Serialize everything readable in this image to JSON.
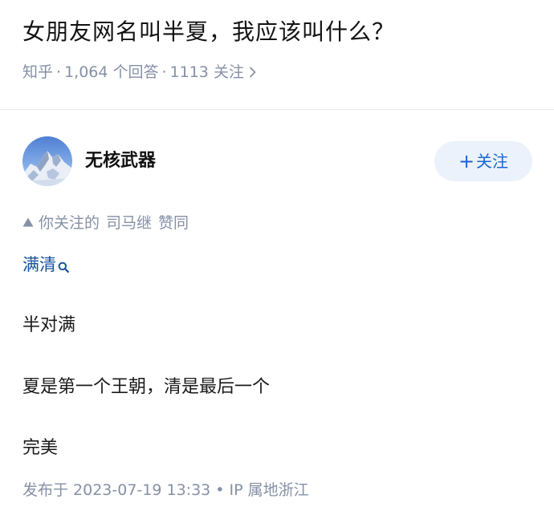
{
  "question": {
    "title": "女朋友网名叫半夏，我应该叫什么？",
    "source": "知乎",
    "answers": "1,064 个回答",
    "followers": "1113 关注",
    "separator": "·"
  },
  "author": {
    "name": "无核武器",
    "follow_label": "关注",
    "follow_plus": "+"
  },
  "upvote": {
    "prefix": "你关注的",
    "voter": "司马继",
    "action": "赞同"
  },
  "answer": {
    "keyword": "满清",
    "paragraphs": [
      "半对满",
      "夏是第一个王朝，清是最后一个",
      "完美"
    ]
  },
  "footer": {
    "published": "发布于 2023-07-19 13:33",
    "separator": "•",
    "ip_location": "IP 属地浙江"
  },
  "colors": {
    "meta_gray": "#8590a6",
    "link_blue": "#175199",
    "follow_blue": "#1a66d1",
    "follow_bg": "#ebf2fb"
  },
  "icons": {
    "meta_more": "chevron-right-icon",
    "upvote": "triangle-up-icon",
    "keyword_search": "search-icon"
  }
}
